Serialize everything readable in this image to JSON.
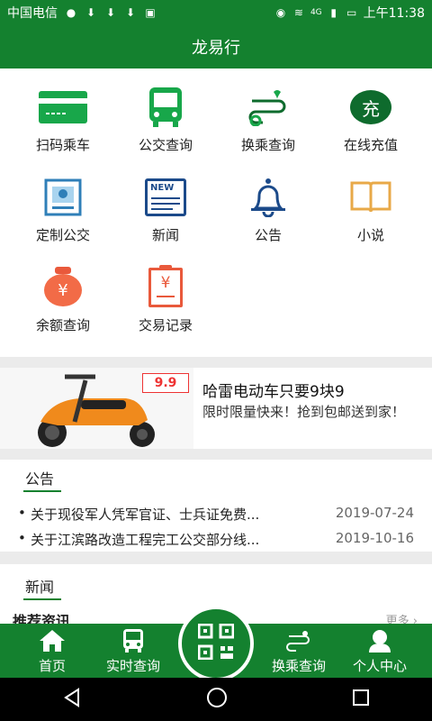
{
  "status_bar": {
    "carrier": "中国电信",
    "time": "上午11:38",
    "network": "4G"
  },
  "app": {
    "title": "龙易行"
  },
  "grid": [
    {
      "label": "扫码乘车",
      "icon": "card-icon"
    },
    {
      "label": "公交查询",
      "icon": "bus-icon"
    },
    {
      "label": "换乘查询",
      "icon": "route-icon"
    },
    {
      "label": "在线充值",
      "icon": "recharge-icon",
      "glyph": "充"
    },
    {
      "label": "定制公交",
      "icon": "custom-bus-icon"
    },
    {
      "label": "新闻",
      "icon": "newspaper-icon",
      "glyph": "NEW"
    },
    {
      "label": "公告",
      "icon": "bell-icon"
    },
    {
      "label": "小说",
      "icon": "book-icon"
    },
    {
      "label": "余额查询",
      "icon": "money-bag-icon",
      "glyph": "¥"
    },
    {
      "label": "交易记录",
      "icon": "clipboard-icon",
      "glyph": "¥"
    }
  ],
  "banner": {
    "title": "哈雷电动车只要9块9",
    "desc": "限时限量快来！抢到包邮送到家！",
    "price_tag": "9.9"
  },
  "notice": {
    "heading": "公告",
    "items": [
      {
        "text": "关于现役军人凭军官证、士兵证免费...",
        "date": "2019-07-24"
      },
      {
        "text": "关于江滨路改造工程完工公交部分线...",
        "date": "2019-10-16"
      }
    ]
  },
  "news": {
    "heading": "新闻",
    "sub": "推荐资讯",
    "more": "更多 ›"
  },
  "tabs": {
    "home": "首页",
    "realtime": "实时查询",
    "transfer": "换乘查询",
    "profile": "个人中心"
  },
  "colors": {
    "brand": "#14812f"
  }
}
